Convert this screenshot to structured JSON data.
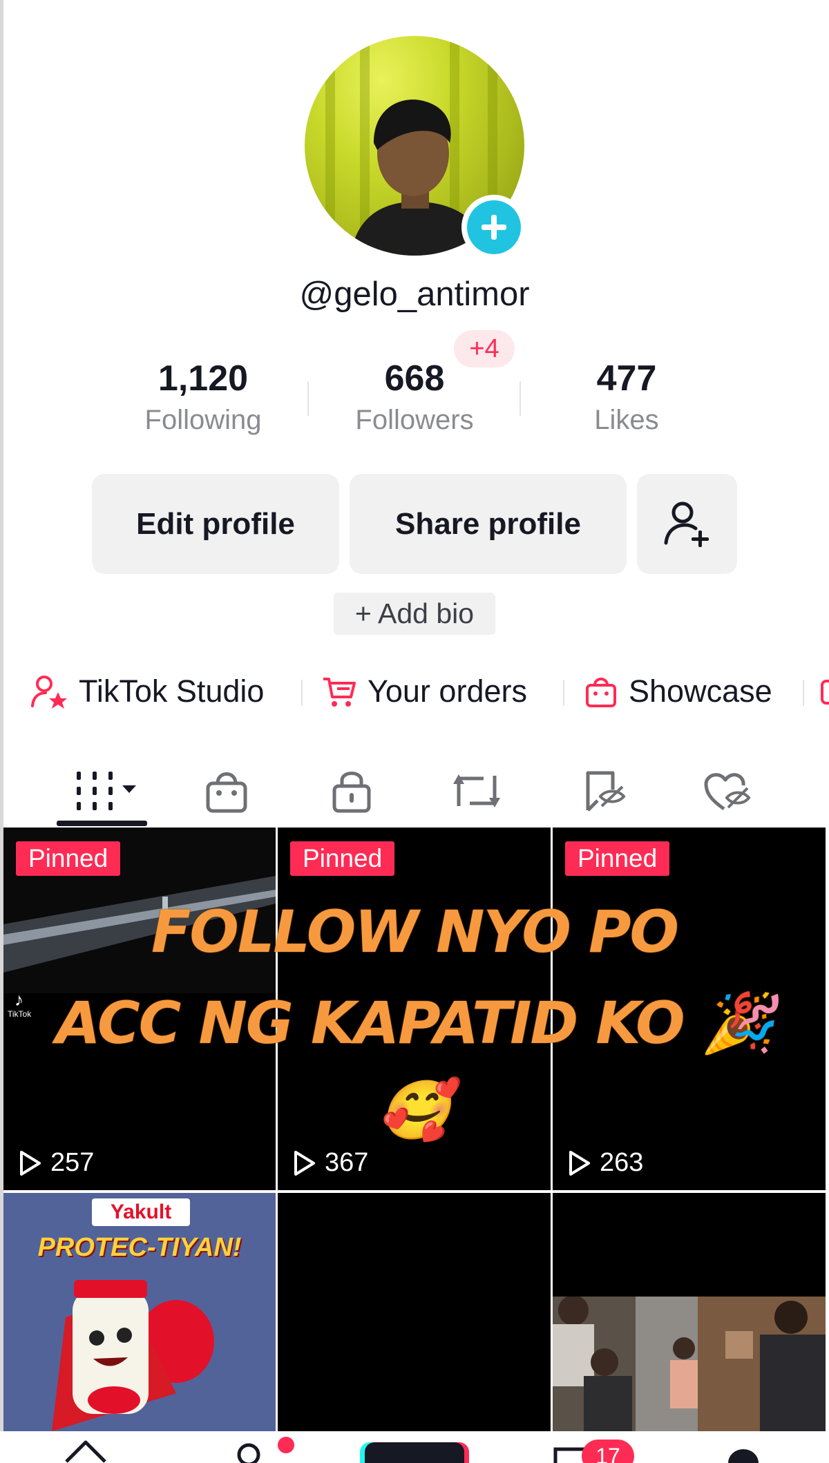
{
  "profile": {
    "username": "@gelo_antimor"
  },
  "stats": {
    "following_count": "1,120",
    "following_label": "Following",
    "followers_count": "668",
    "followers_label": "Followers",
    "followers_new": "+4",
    "likes_count": "477",
    "likes_label": "Likes"
  },
  "actions": {
    "edit_profile": "Edit profile",
    "share_profile": "Share profile",
    "add_bio": "+ Add bio"
  },
  "links": {
    "studio": "TikTok Studio",
    "orders": "Your orders",
    "showcase": "Showcase"
  },
  "tabs": [
    "grid-icon",
    "shop-bag-icon",
    "lock-icon",
    "repost-icon",
    "favorites-hidden-icon",
    "liked-hidden-icon"
  ],
  "videos": [
    {
      "pinned": "Pinned",
      "views": "257",
      "watermark": "TikTok"
    },
    {
      "pinned": "Pinned",
      "views": "367"
    },
    {
      "pinned": "Pinned",
      "views": "263"
    },
    {
      "brand": "Yakult",
      "headline": "PROTEC-TIYAN!"
    },
    {},
    {}
  ],
  "overlay_text": {
    "line1": "FOLLOW NYO PO",
    "line2": "ACC NG KAPATID KO 🎉",
    "line3": "🥰"
  },
  "nav": {
    "inbox_badge": "17"
  },
  "colors": {
    "accent": "#fe2c55",
    "avatar_add": "#20c4e0",
    "overlay_text": "#f79a3f"
  }
}
